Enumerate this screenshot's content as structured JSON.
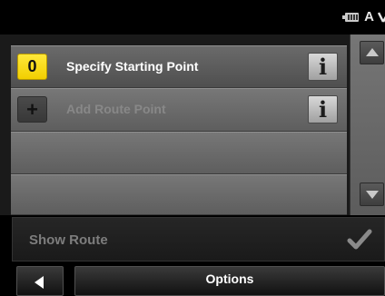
{
  "status_bar": {
    "icons": [
      "battery-icon",
      "alert-icon",
      "gps-signal-icon"
    ],
    "alert_glyph": "A"
  },
  "route_list": {
    "items": [
      {
        "index": "0",
        "label": "Specify Starting Point",
        "state": "active",
        "info_icon": "info-icon"
      },
      {
        "index": "+",
        "label": "Add Route Point",
        "state": "disabled",
        "info_icon": "info-icon"
      },
      {
        "index": "",
        "label": "",
        "state": "empty"
      },
      {
        "index": "",
        "label": "",
        "state": "empty"
      }
    ],
    "info_glyph": "i"
  },
  "scrollbar": {
    "up_icon": "triangle-up-icon",
    "down_icon": "triangle-down-icon"
  },
  "show_route": {
    "label": "Show Route",
    "icon": "checkmark-icon",
    "enabled": false
  },
  "bottom_bar": {
    "back_icon": "triangle-left-icon",
    "options_label": "Options"
  },
  "colors": {
    "accent_yellow": "#f2cf00",
    "background": "#000000",
    "text_primary": "#ffffff",
    "text_disabled": "#7d7d7d"
  }
}
